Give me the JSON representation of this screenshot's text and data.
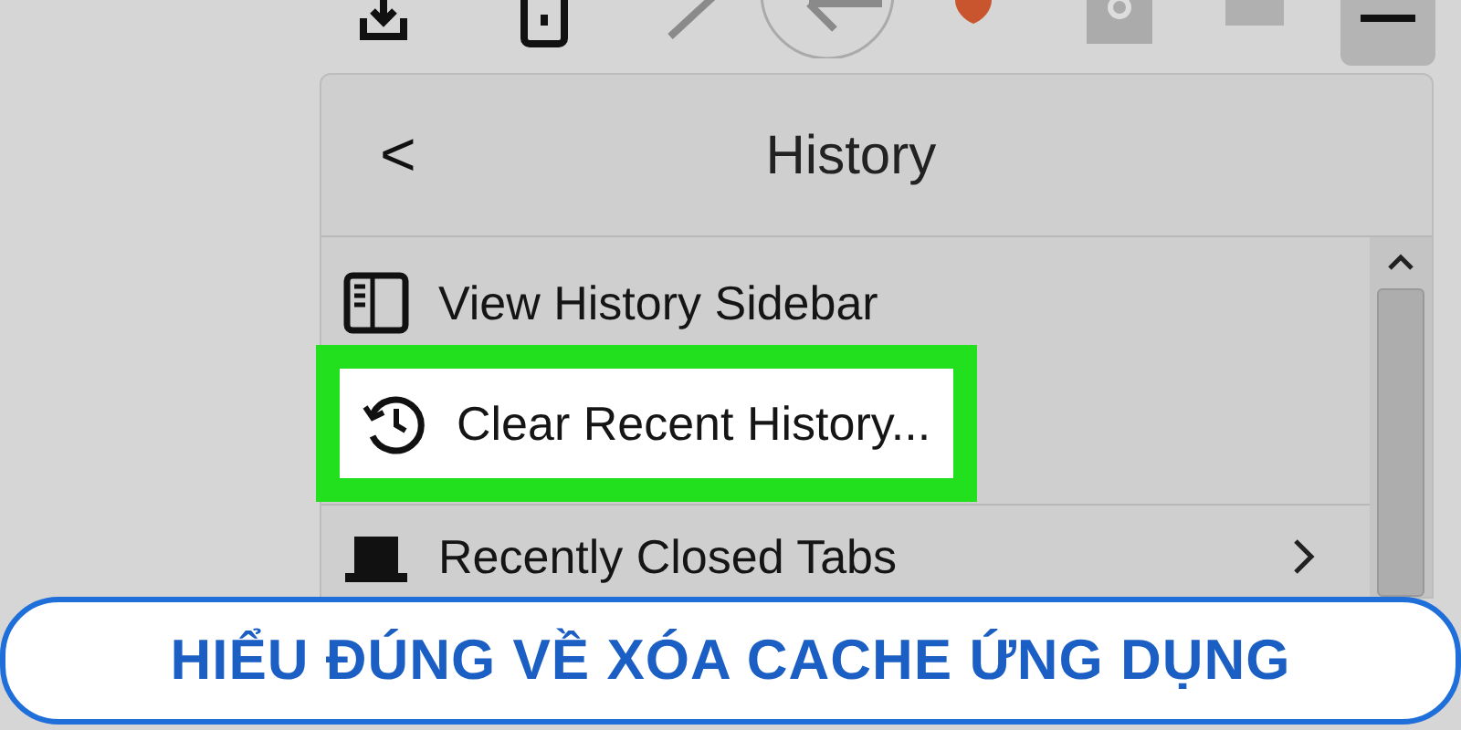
{
  "menu": {
    "title": "History",
    "back": "<",
    "items": [
      {
        "label": "View History Sidebar",
        "kind": "sidebar",
        "highlighted": false,
        "submenu": false
      },
      {
        "label": "Clear Recent History...",
        "kind": "clock",
        "highlighted": true,
        "submenu": false
      },
      {
        "label": "Recently Closed Tabs",
        "kind": "tab",
        "highlighted": false,
        "submenu": true
      }
    ]
  },
  "banner": {
    "text": "HIỂU ĐÚNG VỀ XÓA CACHE ỨNG DỤNG"
  }
}
